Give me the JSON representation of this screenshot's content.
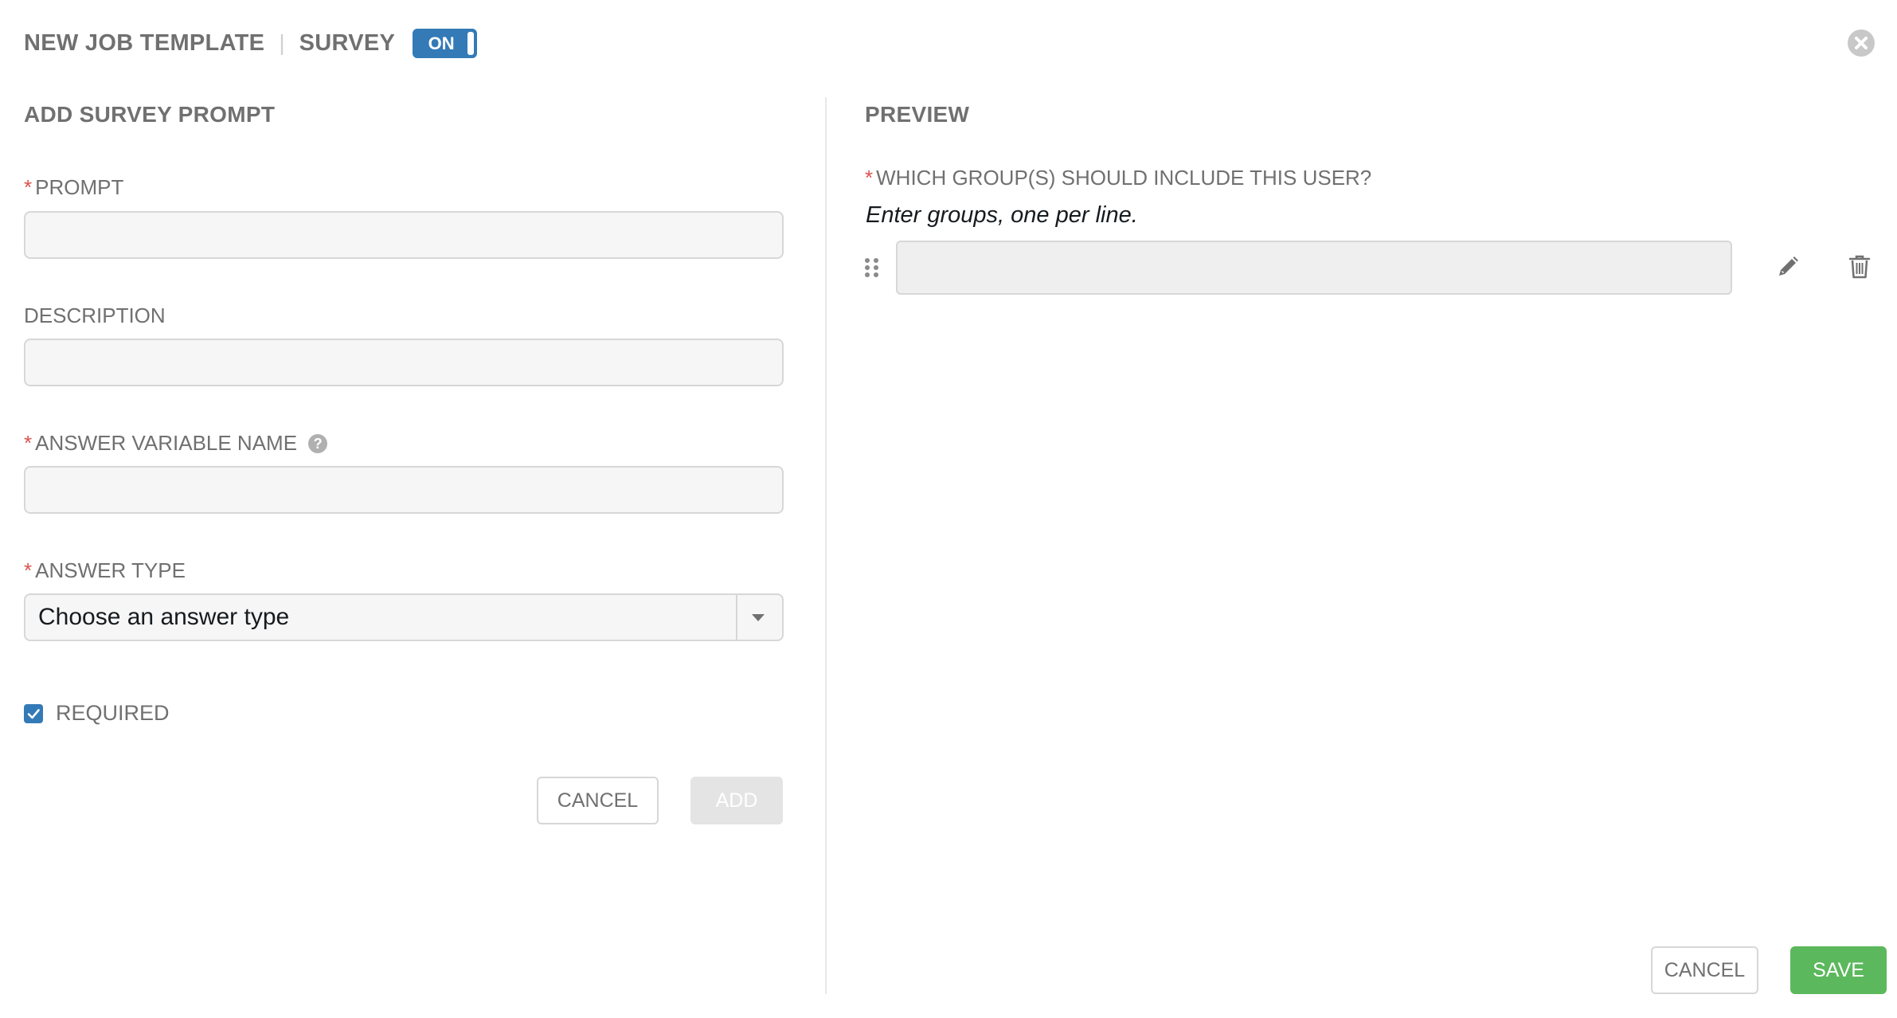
{
  "header": {
    "title": "NEW JOB TEMPLATE",
    "separator": "|",
    "subtitle": "SURVEY",
    "survey_toggle": "ON"
  },
  "left_panel": {
    "title": "ADD SURVEY PROMPT",
    "prompt": {
      "label": "PROMPT",
      "required": true,
      "value": ""
    },
    "description": {
      "label": "DESCRIPTION",
      "required": false,
      "value": ""
    },
    "variable_name": {
      "label": "ANSWER VARIABLE NAME",
      "required": true,
      "value": ""
    },
    "answer_type": {
      "label": "ANSWER TYPE",
      "required": true,
      "selected": "Choose an answer type"
    },
    "required_checkbox": {
      "label": "REQUIRED",
      "checked": true
    },
    "cancel_label": "CANCEL",
    "add_label": "ADD"
  },
  "preview": {
    "title": "PREVIEW",
    "question": {
      "required_marker": "*",
      "label": "WHICH GROUP(S) SHOULD INCLUDE THIS USER?",
      "description": "Enter groups, one per line."
    }
  },
  "footer": {
    "cancel_label": "CANCEL",
    "save_label": "SAVE"
  },
  "colors": {
    "accent": "#337ab7",
    "success": "#5cb85c",
    "required": "#d9534f",
    "text_muted": "#707070"
  },
  "icons": [
    "close-icon",
    "help-icon",
    "chevron-down-icon",
    "check-icon",
    "drag-handle-icon",
    "pencil-icon",
    "trash-icon"
  ]
}
